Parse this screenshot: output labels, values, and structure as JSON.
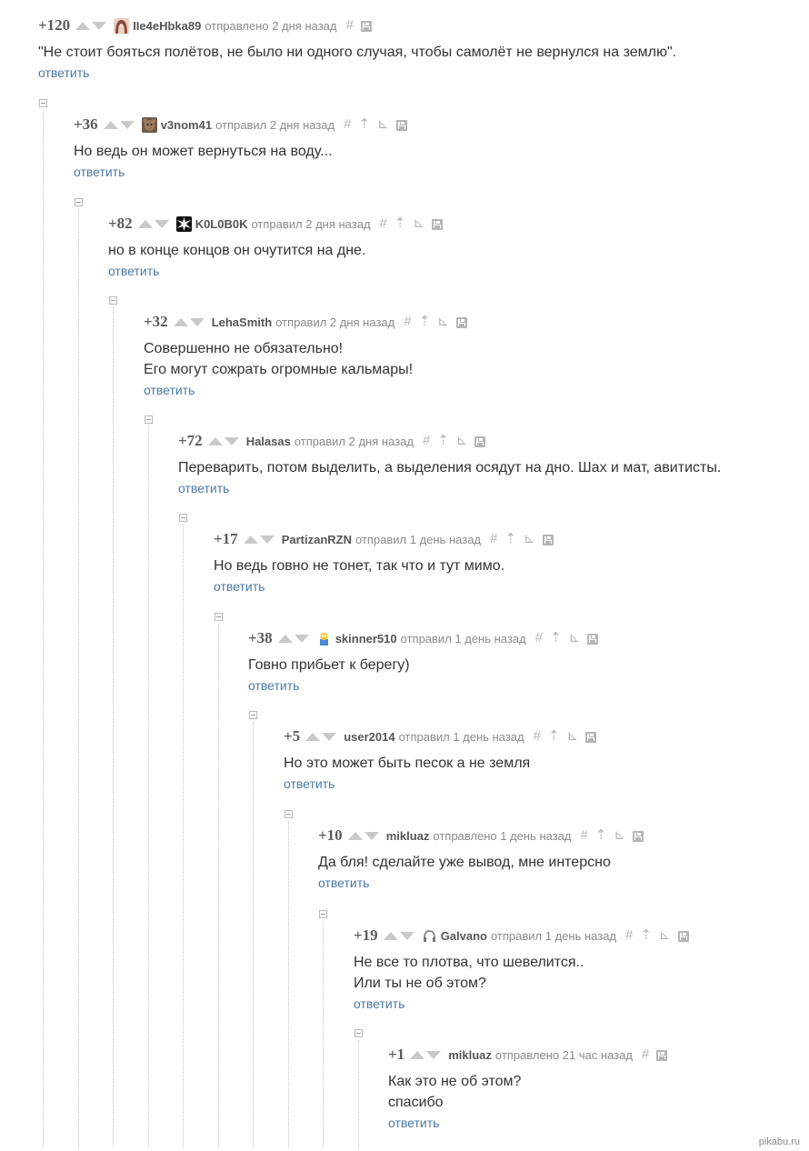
{
  "comments": [
    {
      "score": "+120",
      "author": "IIe4eHbka89",
      "meta": "отправлено 2 дня назад",
      "avatar": "girl-avatar",
      "lines": [
        "\"Не стоит бояться полётов, не было ни одного случая, чтобы самолёт не вернулся на землю\"."
      ],
      "reply": "ответить",
      "extra_icons": false
    },
    {
      "score": "+36",
      "author": "v3nom41",
      "meta": "отправил 2 дня назад",
      "avatar": "bear-avatar",
      "lines": [
        "Но ведь он может вернуться на воду..."
      ],
      "reply": "ответить",
      "extra_icons": true
    },
    {
      "score": "+82",
      "author": "K0L0B0K",
      "meta": "отправил 2 дня назад",
      "avatar": "splat-avatar",
      "lines": [
        "но в конце концов он очутится на дне."
      ],
      "reply": "ответить",
      "extra_icons": true
    },
    {
      "score": "+32",
      "author": "LehaSmith",
      "meta": "отправил 2 дня назад",
      "avatar": "",
      "lines": [
        "Совершенно не обязательно!",
        "Его могут сожрать огромные кальмары!"
      ],
      "reply": "ответить",
      "extra_icons": true
    },
    {
      "score": "+72",
      "author": "Halasas",
      "meta": "отправил 2 дня назад",
      "avatar": "",
      "lines": [
        "Переварить, потом выделить, а выделения осядут на дно. Шах и мат, авитисты."
      ],
      "reply": "ответить",
      "extra_icons": true
    },
    {
      "score": "+17",
      "author": "PartizanRZN",
      "meta": "отправил 1 день назад",
      "avatar": "",
      "lines": [
        "Но ведь говно не тонет, так что и тут мимо."
      ],
      "reply": "ответить",
      "extra_icons": true
    },
    {
      "score": "+38",
      "author": "skinner510",
      "meta": "отправил 1 день назад",
      "avatar": "simpson-avatar",
      "lines": [
        "Говно прибьет к берегу)"
      ],
      "reply": "ответить",
      "extra_icons": true
    },
    {
      "score": "+5",
      "author": "user2014",
      "meta": "отправил 1 день назад",
      "avatar": "",
      "lines": [
        "Но это может быть песок а не земля"
      ],
      "reply": "ответить",
      "extra_icons": true
    },
    {
      "score": "+10",
      "author": "mikluaz",
      "meta": "отправлено 1 день назад",
      "avatar": "",
      "lines": [
        "Да бля! сделайте уже вывод, мне интерсно"
      ],
      "reply": "ответить",
      "extra_icons": true
    },
    {
      "score": "+19",
      "author": "Galvano",
      "meta": "отправил 1 день назад",
      "avatar": "headphones-avatar",
      "lines": [
        "Не все то плотва, что шевелится..",
        "Или ты не об этом?"
      ],
      "reply": "ответить",
      "extra_icons": true
    },
    {
      "score": "+1",
      "author": "mikluaz",
      "meta": "отправлено 21 час назад",
      "avatar": "",
      "lines": [
        "Как это не об этом?",
        "спасибо"
      ],
      "reply": "ответить",
      "extra_icons": false
    }
  ],
  "icons": {
    "link": "#",
    "parent": "⇡",
    "branch": "⊾",
    "save": "save-icon"
  },
  "watermark": "pikabu.ru"
}
